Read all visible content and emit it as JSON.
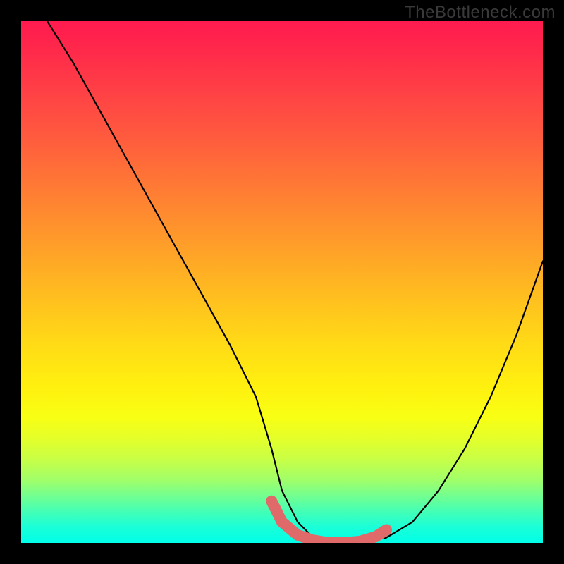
{
  "watermark": "TheBottleneck.com",
  "chart_data": {
    "type": "line",
    "title": "",
    "xlabel": "",
    "ylabel": "",
    "xlim": [
      0,
      100
    ],
    "ylim": [
      0,
      100
    ],
    "series": [
      {
        "name": "bottleneck-curve",
        "x": [
          5,
          10,
          15,
          20,
          25,
          30,
          35,
          40,
          45,
          48,
          50,
          53,
          56,
          59,
          62,
          65,
          70,
          75,
          80,
          85,
          90,
          95,
          100
        ],
        "values": [
          100,
          92,
          83,
          74,
          65,
          56,
          47,
          38,
          28,
          18,
          10,
          4,
          1,
          0,
          0,
          0,
          1,
          4,
          10,
          18,
          28,
          40,
          54
        ]
      }
    ],
    "marker_segment": {
      "name": "optimal-range",
      "x": [
        48,
        50,
        53,
        56,
        59,
        62,
        65,
        68,
        70
      ],
      "values": [
        8,
        4,
        1.5,
        0.5,
        0,
        0,
        0.3,
        1.2,
        2.5
      ]
    },
    "gradient_stops": [
      {
        "pos": 0,
        "color": "#ff1a4f"
      },
      {
        "pos": 50,
        "color": "#ffc21e"
      },
      {
        "pos": 75,
        "color": "#fff00f"
      },
      {
        "pos": 100,
        "color": "#00ffe8"
      }
    ]
  }
}
